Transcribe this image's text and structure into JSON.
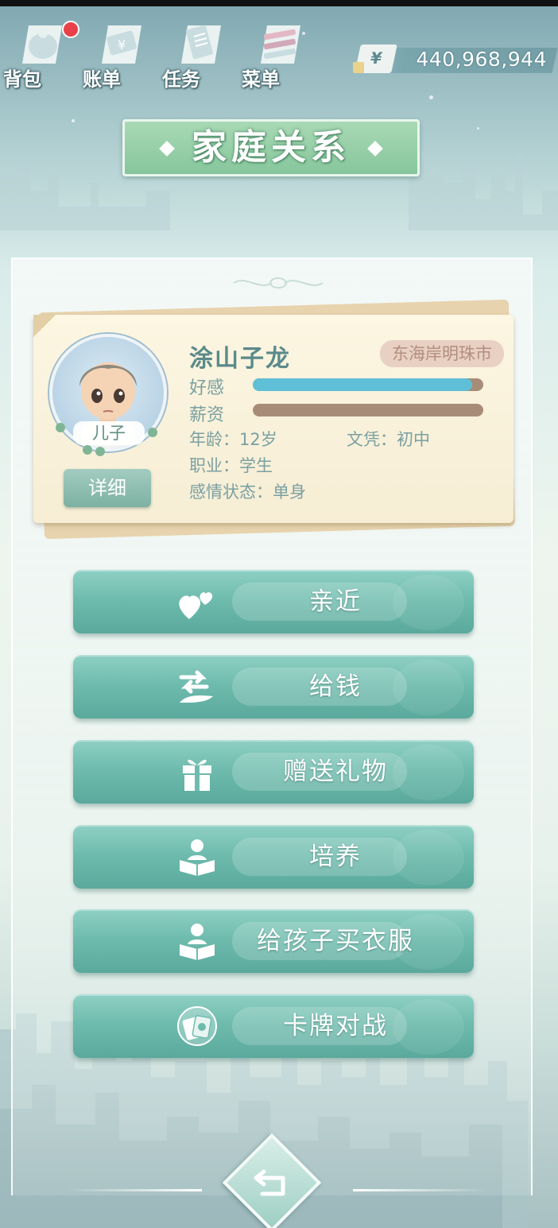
{
  "top_menu": {
    "items": [
      {
        "label": "背包",
        "icon": "bag-icon",
        "has_notification": true
      },
      {
        "label": "账单",
        "icon": "bill-icon",
        "has_notification": false
      },
      {
        "label": "任务",
        "icon": "task-icon",
        "has_notification": false
      },
      {
        "label": "菜单",
        "icon": "menu-icon",
        "has_notification": false
      }
    ],
    "money": {
      "currency_symbol": "¥",
      "value": "440,968,944"
    }
  },
  "page_title": "家庭关系",
  "character": {
    "name": "涂山子龙",
    "location": "东海岸明珠市",
    "role": "儿子",
    "detail_button": "详细",
    "stats": [
      {
        "label": "好感",
        "value": 0.95,
        "color": "#5fbfd6"
      },
      {
        "label": "薪资",
        "value": 0.0,
        "color": "#a78d78"
      }
    ],
    "info": {
      "age_label": "年龄：",
      "age": "12岁",
      "education_label": "文凭：",
      "education": "初中",
      "job_label": "职业：",
      "job": "学生",
      "relationship_label": "感情状态：",
      "relationship": "单身"
    }
  },
  "actions": [
    {
      "label": "亲近",
      "icon": "hearts-icon"
    },
    {
      "label": "给钱",
      "icon": "give-money-icon"
    },
    {
      "label": "赠送礼物",
      "icon": "gift-icon"
    },
    {
      "label": "培养",
      "icon": "reading-person-icon"
    },
    {
      "label": "给孩子买衣服",
      "icon": "reading-person-icon"
    },
    {
      "label": "卡牌对战",
      "icon": "cards-icon"
    }
  ],
  "colors": {
    "accent": "#6fbcae",
    "title_bg": "#86c69c",
    "affection_bar": "#5fbfd6",
    "salary_bar": "#a78d78",
    "notification": "#e8414a"
  }
}
